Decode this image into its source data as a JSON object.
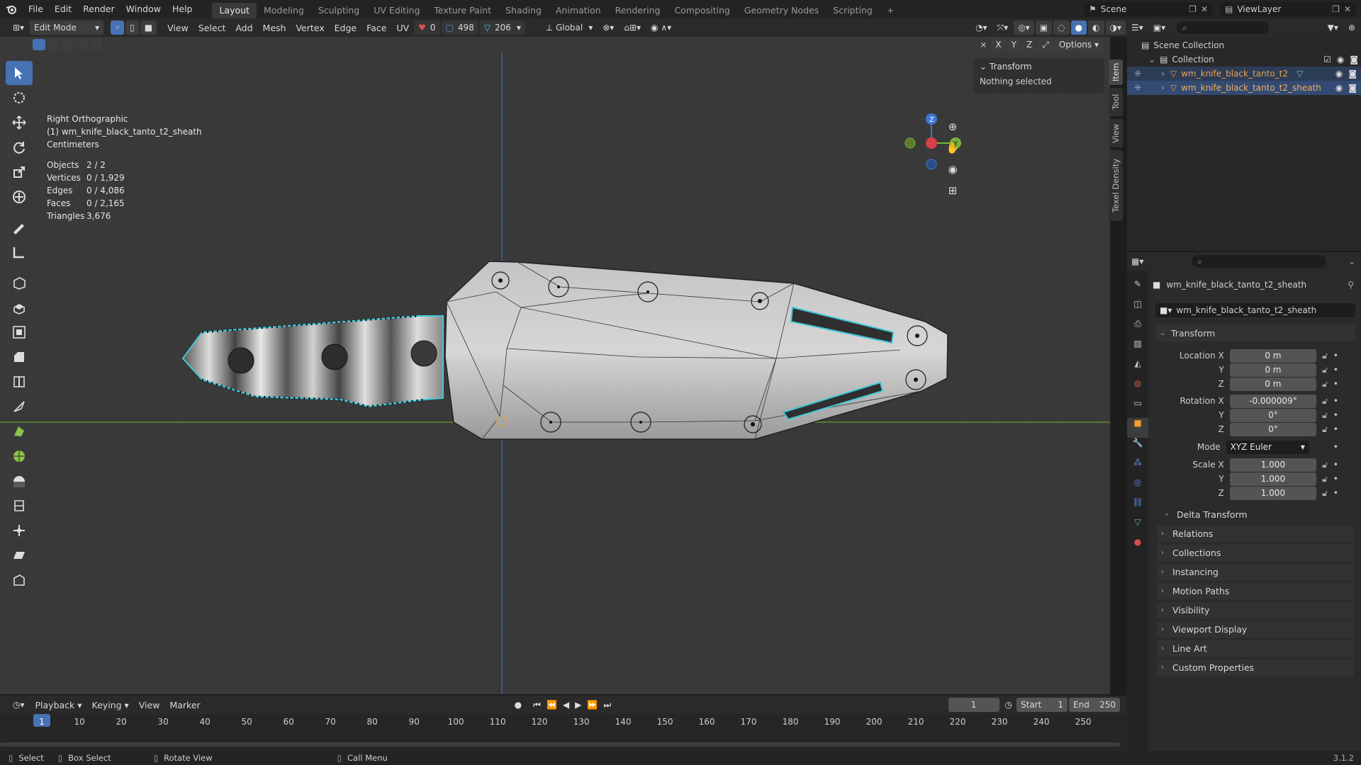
{
  "topbar": {
    "menus": [
      "File",
      "Edit",
      "Render",
      "Window",
      "Help"
    ],
    "workspaces": [
      "Layout",
      "Modeling",
      "Sculpting",
      "UV Editing",
      "Texture Paint",
      "Shading",
      "Animation",
      "Rendering",
      "Compositing",
      "Geometry Nodes",
      "Scripting"
    ],
    "active_workspace": "Layout",
    "scene": "Scene",
    "view_layer": "ViewLayer"
  },
  "view_header": {
    "mode": "Edit Mode",
    "menus": [
      "View",
      "Select",
      "Add",
      "Mesh",
      "Vertex",
      "Edge",
      "Face",
      "UV"
    ],
    "count_red": "0",
    "count_blue": "498",
    "count_teal": "206",
    "orientation": "Global",
    "options": "Options",
    "axes": [
      "X",
      "Y",
      "Z"
    ]
  },
  "overlay": {
    "view_name": "Right Orthographic",
    "object_name": "(1) wm_knife_black_tanto_t2_sheath",
    "units": "Centimeters",
    "stats": [
      {
        "label": "Objects",
        "value": "2 / 2"
      },
      {
        "label": "Vertices",
        "value": "0 / 1,929"
      },
      {
        "label": "Edges",
        "value": "0 / 4,086"
      },
      {
        "label": "Faces",
        "value": "0 / 2,165"
      },
      {
        "label": "Triangles",
        "value": "3,676"
      }
    ]
  },
  "npanel": {
    "title": "Transform",
    "message": "Nothing selected",
    "tabs": [
      "Item",
      "Tool",
      "View",
      "Texel Density"
    ]
  },
  "outliner": {
    "root": "Scene Collection",
    "collection": "Collection",
    "items": [
      "wm_knife_black_tanto_t2",
      "wm_knife_black_tanto_t2_sheath"
    ]
  },
  "properties": {
    "object_name": "wm_knife_black_tanto_t2_sheath",
    "datablock": "wm_knife_black_tanto_t2_sheath",
    "section": "Transform",
    "location": {
      "label": "Location X",
      "x": "0 m",
      "y": "0 m",
      "z": "0 m"
    },
    "rotation": {
      "label": "Rotation X",
      "x": "-0.000009°",
      "y": "0°",
      "z": "0°"
    },
    "mode_label": "Mode",
    "mode_value": "XYZ Euler",
    "scale": {
      "label": "Scale X",
      "x": "1.000",
      "y": "1.000",
      "z": "1.000"
    },
    "axis_y": "Y",
    "axis_z": "Z",
    "subsections": [
      "Delta Transform",
      "Relations",
      "Collections",
      "Instancing",
      "Motion Paths",
      "Visibility",
      "Viewport Display",
      "Line Art",
      "Custom Properties"
    ]
  },
  "timeline": {
    "menus": [
      "Playback",
      "Keying",
      "View",
      "Marker"
    ],
    "current_frame": "1",
    "start_label": "Start",
    "start": "1",
    "end_label": "End",
    "end": "250",
    "ticks": [
      "1",
      "10",
      "20",
      "30",
      "40",
      "50",
      "60",
      "70",
      "80",
      "90",
      "100",
      "110",
      "120",
      "130",
      "140",
      "150",
      "160",
      "170",
      "180",
      "190",
      "200",
      "210",
      "220",
      "230",
      "240",
      "250"
    ]
  },
  "statusbar": {
    "items": [
      "Select",
      "Box Select",
      "Rotate View",
      "Call Menu"
    ],
    "version": "3.1.2"
  }
}
